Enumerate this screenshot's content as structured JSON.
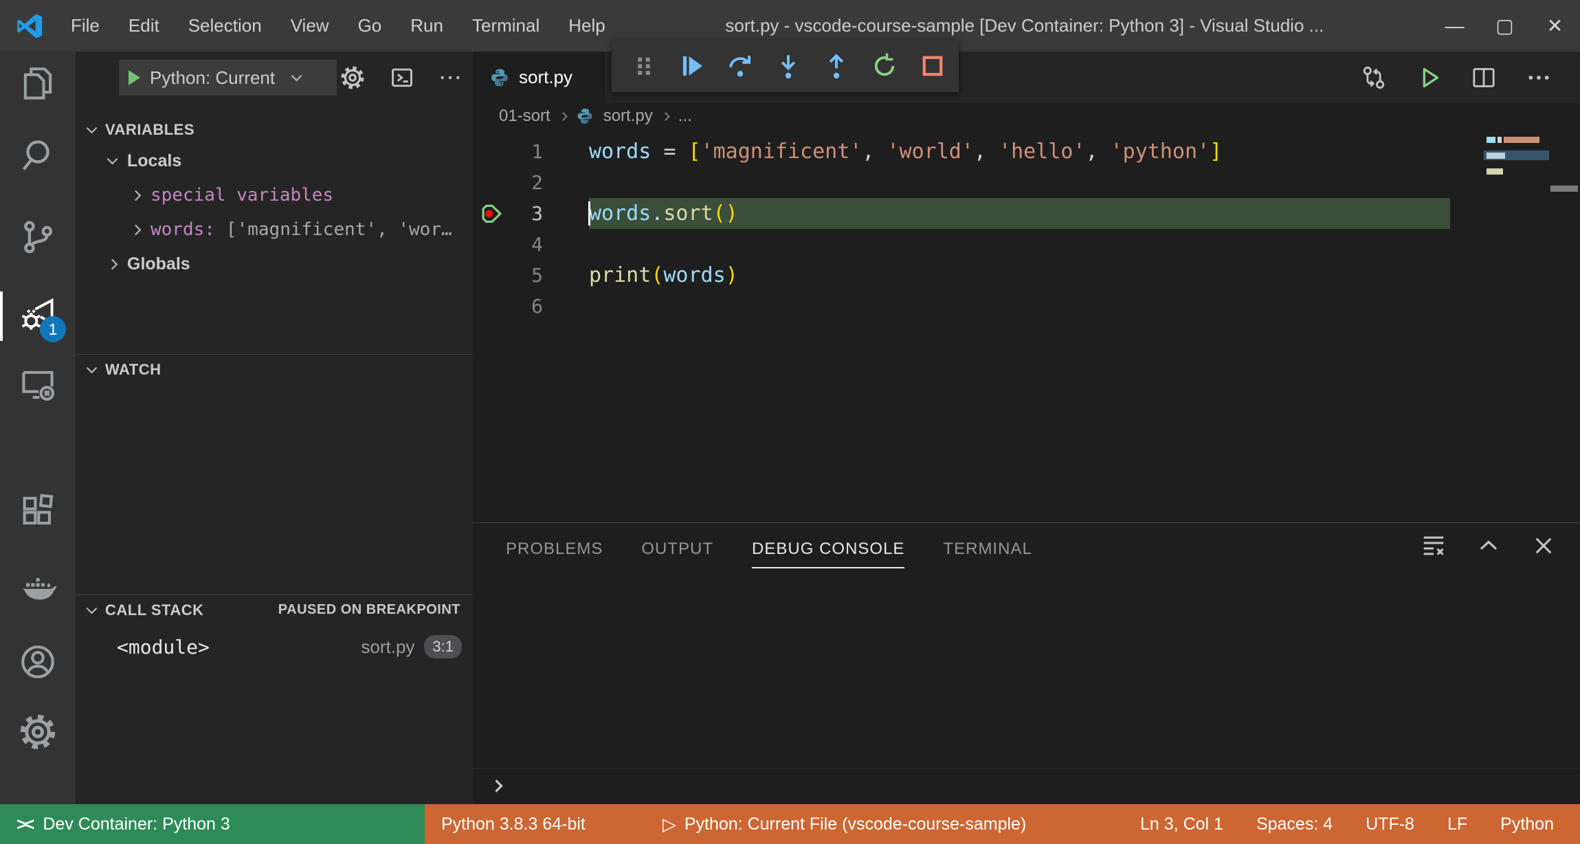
{
  "window": {
    "menus": [
      "File",
      "Edit",
      "Selection",
      "View",
      "Go",
      "Run",
      "Terminal",
      "Help"
    ],
    "title": "sort.py - vscode-course-sample [Dev Container: Python 3] - Visual Studio ...",
    "controls": {
      "minimize": "—",
      "maximize": "▢",
      "close": "✕"
    }
  },
  "activity_bar": {
    "items": [
      "explorer",
      "search",
      "source-control",
      "run-and-debug",
      "remote-explorer",
      "extensions",
      "docker",
      "accounts",
      "settings"
    ],
    "active": "run-and-debug",
    "debug_badge": "1"
  },
  "sidebar": {
    "launch": {
      "label": "Python: Current"
    },
    "actions": [
      "settings-gear",
      "open-debug-console",
      "more-actions"
    ],
    "more_glyph": "⋯",
    "variables": {
      "title": "VARIABLES",
      "locals_label": "Locals",
      "special": "special variables",
      "words_name": "words: ",
      "words_value": "['magnificent', 'wor…",
      "globals_label": "Globals"
    },
    "watch": {
      "title": "WATCH"
    },
    "call_stack": {
      "title": "CALL STACK",
      "status": "PAUSED ON BREAKPOINT",
      "frame_name": "<module>",
      "frame_file": "sort.py",
      "frame_pos": "3:1"
    }
  },
  "editor": {
    "tab": {
      "label": "sort.py",
      "icon": "python"
    },
    "actions": [
      "open-changes",
      "run-python-file",
      "split-editor",
      "more-actions"
    ],
    "breadcrumbs": {
      "folder": "01-sort",
      "file": "sort.py",
      "symbol": "..."
    },
    "paused_line": "3",
    "lines": [
      {
        "num": "1",
        "tokens": {
          "t0": "words",
          "t1": " = ",
          "t2": "[",
          "t3": "'magnificent'",
          "t4": ", ",
          "t5": "'world'",
          "t6": ", ",
          "t7": "'hello'",
          "t8": ", ",
          "t9": "'python'",
          "t10": "]"
        }
      },
      {
        "num": "2"
      },
      {
        "num": "3",
        "tokens": {
          "t0": "words",
          "t1": ".",
          "t2": "sort",
          "t3": "()"
        }
      },
      {
        "num": "4"
      },
      {
        "num": "5",
        "tokens": {
          "t0": "print",
          "t1": "(",
          "t2": "words",
          "t3": ")"
        }
      },
      {
        "num": "6"
      }
    ]
  },
  "debug_toolbar": {
    "buttons": [
      "gripper",
      "continue",
      "step-over",
      "step-into",
      "step-out",
      "restart",
      "stop"
    ]
  },
  "panel": {
    "tabs": [
      "PROBLEMS",
      "OUTPUT",
      "DEBUG CONSOLE",
      "TERMINAL"
    ],
    "active_tab": "DEBUG CONSOLE",
    "actions": [
      "clear-console",
      "maximize-panel",
      "close-panel"
    ]
  },
  "status_bar": {
    "remote_label": "Dev Container: Python 3",
    "interpreter": "Python 3.8.3 64-bit",
    "debug_config": "Python: Current File (vscode-course-sample)",
    "right": [
      "Ln 3, Col 1",
      "Spaces: 4",
      "UTF-8",
      "LF",
      "Python"
    ]
  },
  "colors": {
    "accent": "#007acc",
    "badge": "#1177bb",
    "debug_statusbar": "#cc6633",
    "remote_statusbar": "#2e8b57",
    "string": "#ce9178",
    "variable": "#9cdcfe",
    "function": "#dcdcaa",
    "bracket": "#ffd700",
    "line_highlight": "#3a4e3a",
    "step_blue": "#75beff",
    "run_green": "#89d185",
    "stop_red": "#f48771",
    "breakpoint_red": "#e51400"
  }
}
